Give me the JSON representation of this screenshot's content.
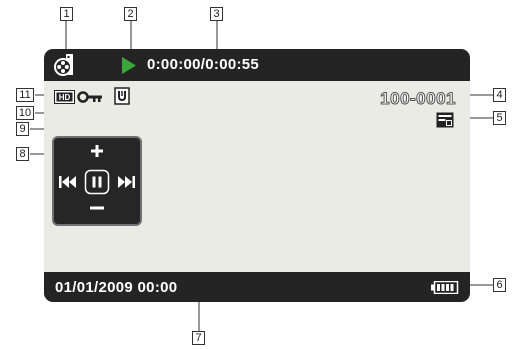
{
  "screen": {
    "time_counter": "0:00:00/0:00:55",
    "date_time": "01/01/2009 00:00",
    "file_number": "100-0001",
    "icons": {
      "mode": "movie-mode-icon",
      "play": "play-icon",
      "hd": "hd-quality-icon",
      "protect_key": "protect-key-icon",
      "protect_status": "protect-status-icon",
      "slideshow": "slideshow-icon",
      "battery": "battery-icon",
      "control_panel": [
        "volume-up-icon",
        "skip-back-icon",
        "pause-icon",
        "skip-forward-icon",
        "volume-down-icon"
      ]
    },
    "colors": {
      "bar": "#242424",
      "screen": "#ebebe5",
      "play": "#3aa63a"
    }
  },
  "callouts": {
    "c1": "1",
    "c2": "2",
    "c3": "3",
    "c4": "4",
    "c5": "5",
    "c6": "6",
    "c7": "7",
    "c8": "8",
    "c9": "9",
    "c10": "10",
    "c11": "11"
  }
}
